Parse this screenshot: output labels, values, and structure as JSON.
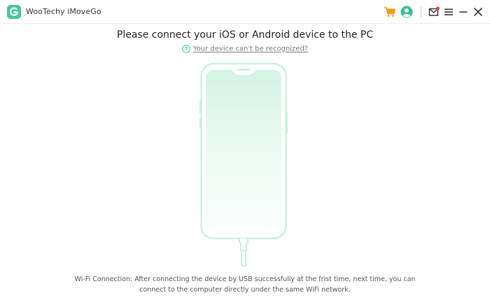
{
  "window": {
    "title": "WooTechy iMoveGo"
  },
  "titlebar_icons": {
    "cart": "cart-icon",
    "account": "user-icon",
    "mail": "mail-icon",
    "menu": "menu-icon",
    "minimize": "minimize-icon",
    "close": "close-icon"
  },
  "colors": {
    "brand": "#43c59a",
    "cart": "#f29b19",
    "account": "#3bbf93",
    "phone_outline": "#c9f1df",
    "phone_fill_top": "#d6f5e6"
  },
  "main": {
    "heading": "Please connect your  iOS or Android device to the PC",
    "help_link": "Your device can't be recognized?",
    "wifi_note_line1": "Wi-Fi Connection: After connecting the device by USB successfully at the frist time, next time, you can",
    "wifi_note_line2": "connect to the computer directly under the same WiFi network."
  }
}
